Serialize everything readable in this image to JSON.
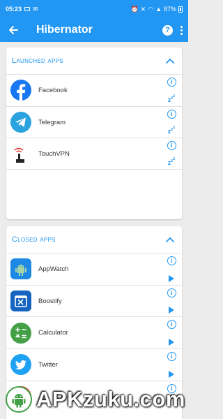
{
  "status_bar": {
    "time": "05:23",
    "battery_percent": "87%"
  },
  "app_bar": {
    "title": "Hibernator"
  },
  "launched_section": {
    "title": "Launched apps",
    "apps": [
      {
        "name": "Facebook",
        "icon": "facebook-icon",
        "color": "#1877f2"
      },
      {
        "name": "Telegram",
        "icon": "telegram-icon",
        "color": "#2aa3df"
      },
      {
        "name": "TouchVPN",
        "icon": "touchvpn-icon",
        "color": "#e53935"
      }
    ]
  },
  "closed_section": {
    "title": "Closed apps",
    "apps": [
      {
        "name": "AppWatch",
        "icon": "appwatch-icon",
        "color": "#1e88e5"
      },
      {
        "name": "Boostify",
        "icon": "boostify-icon",
        "color": "#1565c0"
      },
      {
        "name": "Calculator",
        "icon": "calculator-icon",
        "color": "#43a047"
      },
      {
        "name": "Twitter",
        "icon": "twitter-icon",
        "color": "#1da1f2"
      },
      {
        "name": "",
        "icon": "chrome-icon",
        "color": "#e53935"
      }
    ]
  },
  "watermark": {
    "text": "APKzuku.com"
  },
  "colors": {
    "primary": "#2196f3",
    "background": "#ececec"
  }
}
